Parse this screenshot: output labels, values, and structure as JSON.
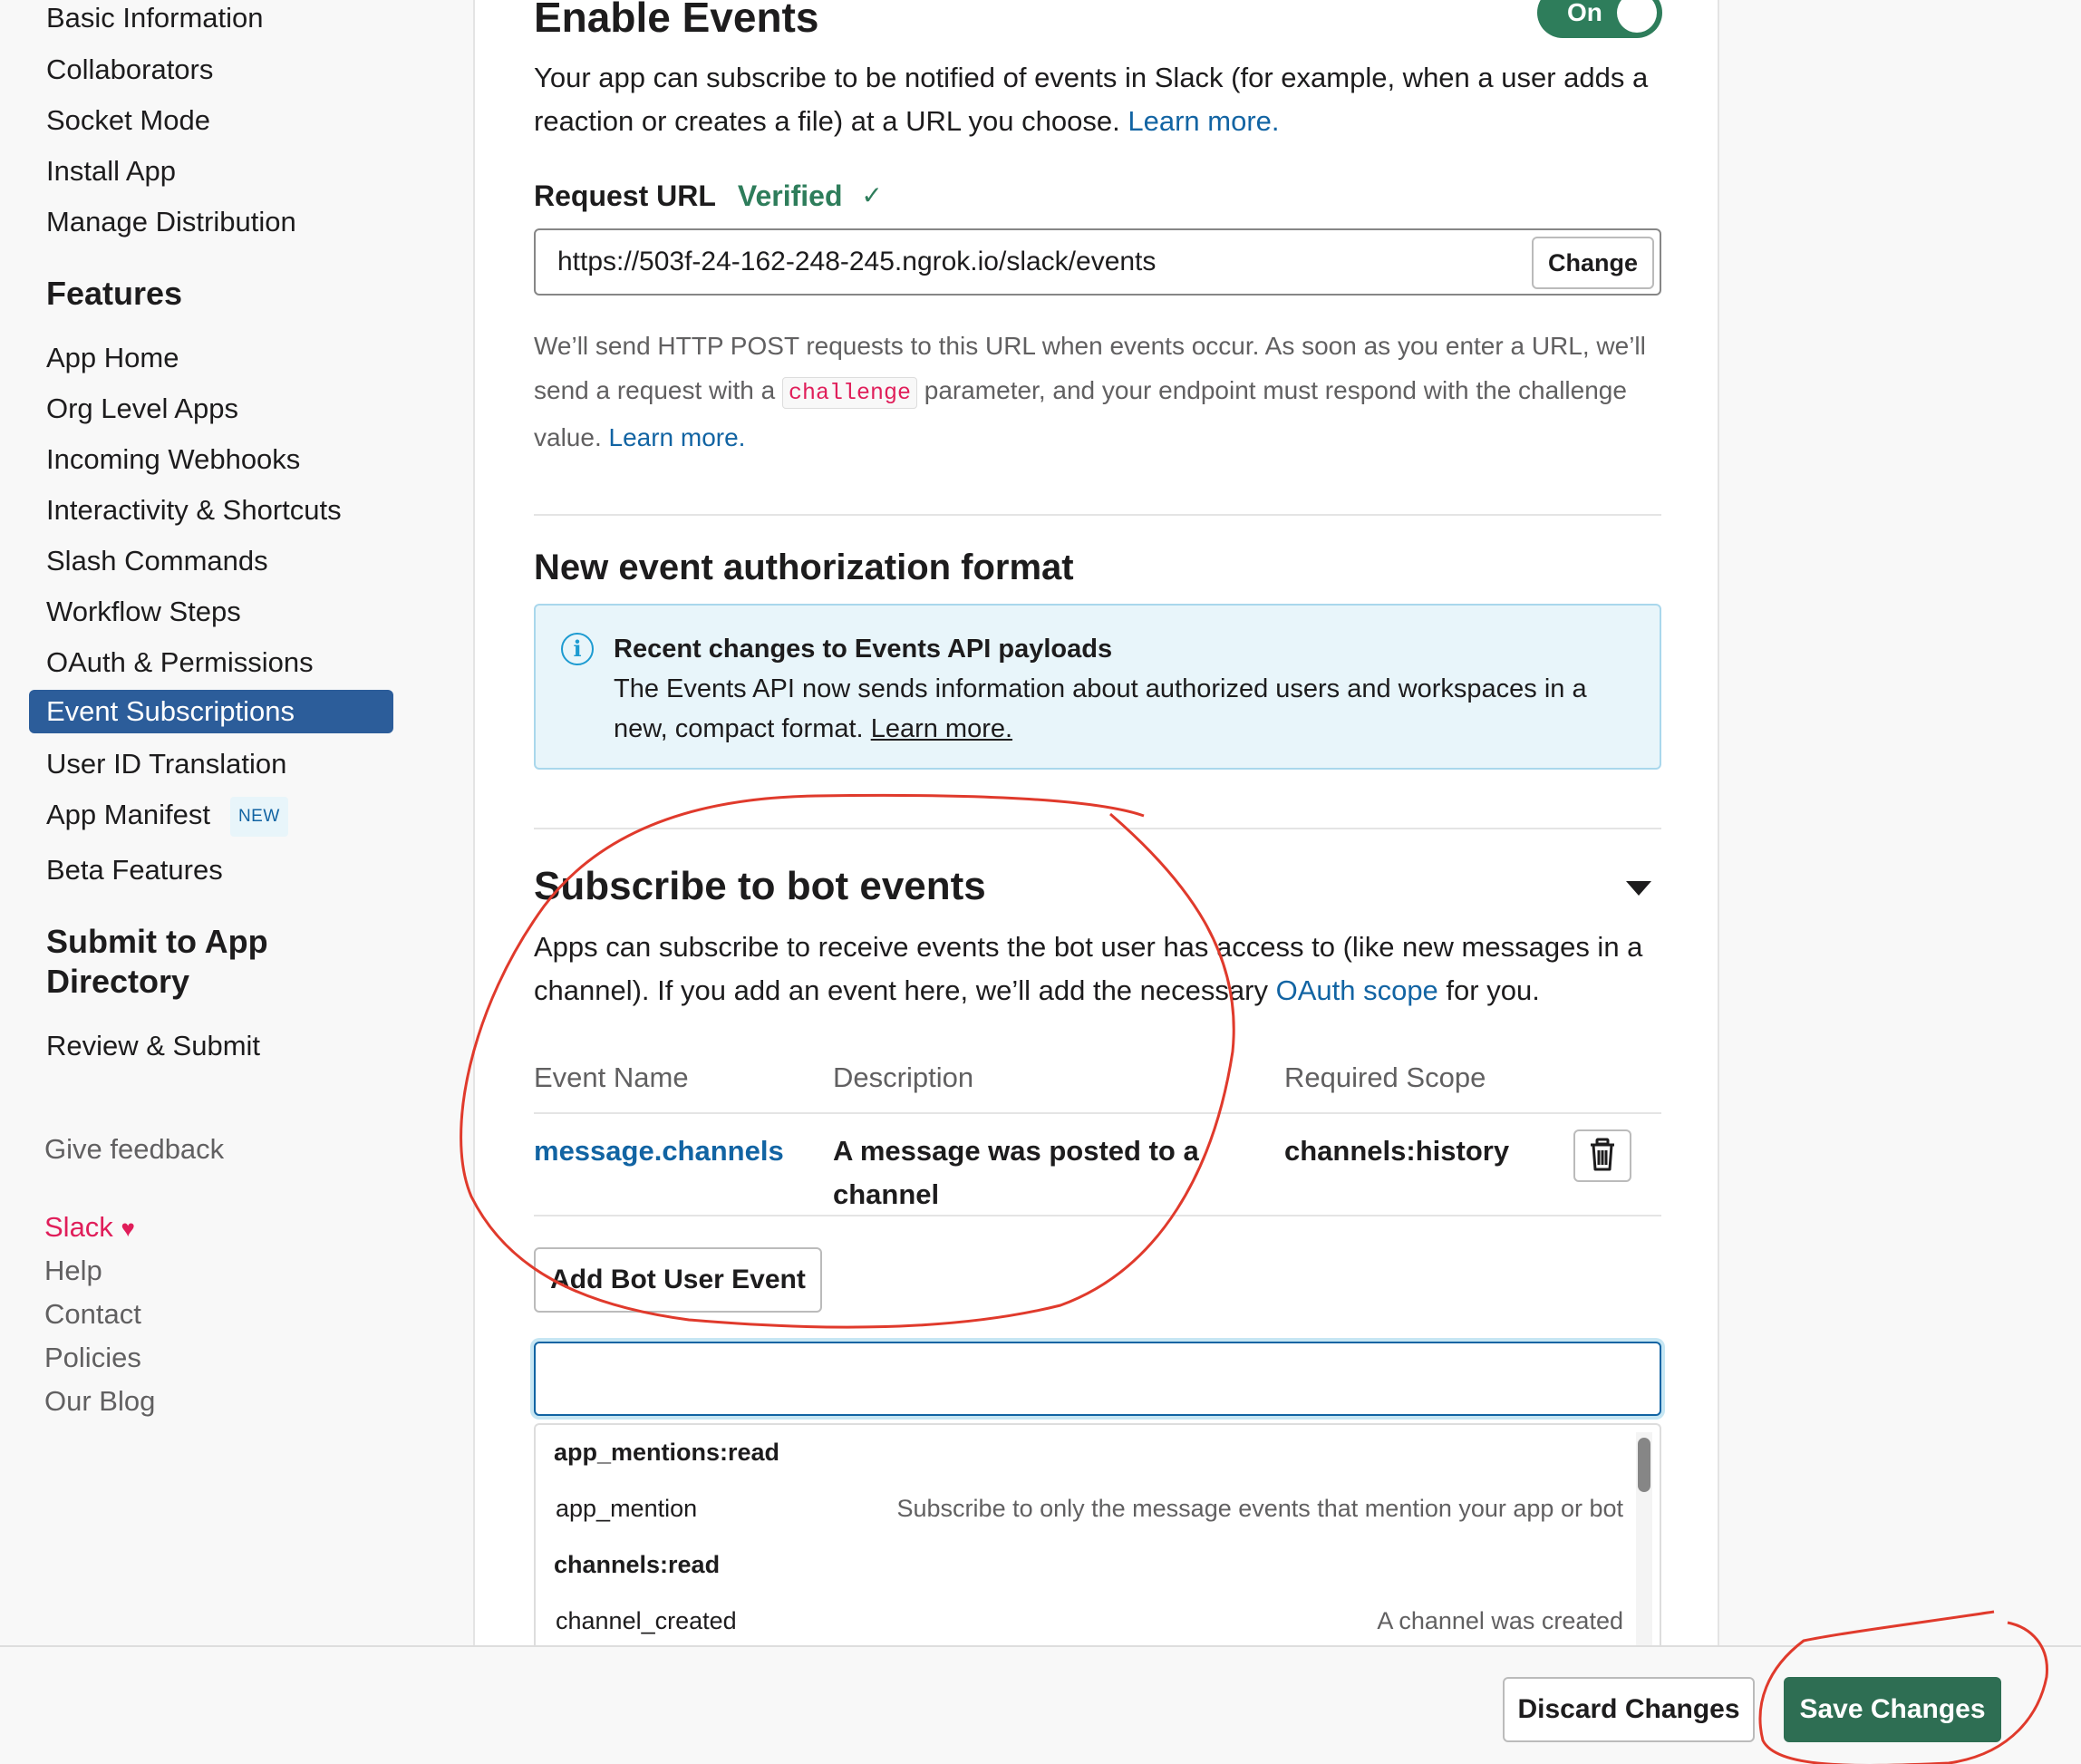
{
  "sidebar": {
    "settings_items": [
      "Basic Information",
      "Collaborators",
      "Socket Mode",
      "Install App",
      "Manage Distribution"
    ],
    "features_heading": "Features",
    "features_items": [
      "App Home",
      "Org Level Apps",
      "Incoming Webhooks",
      "Interactivity & Shortcuts",
      "Slash Commands",
      "Workflow Steps",
      "OAuth & Permissions",
      "Event Subscriptions",
      "User ID Translation",
      "App Manifest",
      "Beta Features"
    ],
    "active_item": "Event Subscriptions",
    "new_badge": "NEW",
    "submit_heading_line1": "Submit to App",
    "submit_heading_line2": "Directory",
    "review_submit": "Review & Submit",
    "give_feedback": "Give feedback",
    "slack": "Slack",
    "heart": "♥",
    "footer_links": [
      "Help",
      "Contact",
      "Policies",
      "Our Blog"
    ]
  },
  "enable_events": {
    "title": "Enable Events",
    "toggle_label": "On",
    "description_line1": "Your app can subscribe to be notified of events in Slack (for example, when a user adds a",
    "description_line2": "reaction or creates a file) at a URL you choose.",
    "learn_more": "Learn more.",
    "request_url_label": "Request URL",
    "verified_label": "Verified",
    "verified_icon": "✓",
    "request_url_value": "https://503f-24-162-248-245.ngrok.io/slack/events",
    "change_button": "Change",
    "help_line1": "We’ll send HTTP POST requests to this URL when events occur. As soon as you enter a URL, we’ll",
    "help_line2_pre": "send a request with a",
    "help_code": "challenge",
    "help_line2_post": "parameter, and your endpoint must respond with the challenge",
    "help_line3_pre": "value.",
    "help_learn_more": "Learn more."
  },
  "auth_format": {
    "title": "New event authorization format",
    "info_title": "Recent changes to Events API payloads",
    "info_body": "The Events API now sends information about authorized users and workspaces in a new, compact format.",
    "info_learn_more": "Learn more."
  },
  "bot_events": {
    "title": "Subscribe to bot events",
    "description_line1": "Apps can subscribe to receive events the bot user has access to (like new messages in a",
    "description_line2_pre": "channel). If you add an event here, we’ll add the necessary",
    "oauth_scope": "OAuth scope",
    "description_line2_post": "for you.",
    "columns": [
      "Event Name",
      "Description",
      "Required Scope"
    ],
    "rows": [
      {
        "event": "message.channels",
        "description": "A message was posted to a channel",
        "scope": "channels:history"
      }
    ],
    "add_button": "Add Bot User Event",
    "search_value": "",
    "dropdown": {
      "groups": [
        {
          "scope": "app_mentions:read",
          "items": [
            {
              "name": "app_mention",
              "desc": "Subscribe to only the message events that mention your app or bot"
            }
          ]
        },
        {
          "scope": "channels:read",
          "items": [
            {
              "name": "channel_created",
              "desc": "A channel was created"
            }
          ]
        }
      ]
    }
  },
  "footer": {
    "discard_button": "Discard Changes",
    "save_button": "Save Changes"
  },
  "colors": {
    "accent_active": "#2c5d9a",
    "link": "#1264a3",
    "success": "#2e7d5b",
    "save": "#2e6e53",
    "annotation": "#e03a2c"
  }
}
